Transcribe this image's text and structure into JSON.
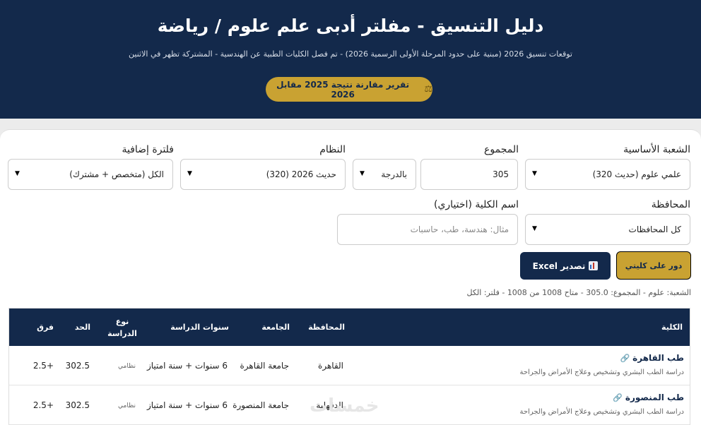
{
  "header": {
    "title": "دليل التنسيق - مفلتر أدبى علم علوم / رياضة",
    "subtitle": "توقعات تنسيق 2026 (مبنية على حدود المرحلة الأولى الرسمية 2026) - تم فصل الكليات الطبية عن الهندسية - المشتركة تظهر في الاثنين",
    "compare_button": "تقرير مقارنة نتيجة 2025 مقابل 2026",
    "compare_icon": "scale-icon"
  },
  "filters": {
    "branch_label": "الشعبة الأساسية",
    "branch_value": "علمي علوم (حديث 320)",
    "total_label": "المجموع",
    "total_value": "305",
    "total_unit": "بالدرجة",
    "system_label": "النظام",
    "system_value": "حديث 2026 (320)",
    "extra_label": "فلترة إضافية",
    "extra_value": "الكل (متخصص + مشترك)",
    "governorate_label": "المحافظة",
    "governorate_value": "كل المحافظات",
    "college_label": "اسم الكلية (اختياري)",
    "college_placeholder": "مثال: هندسة، طب، حاسبات"
  },
  "actions": {
    "find_label": "دور على كليتي",
    "export_label": "تصدير Excel",
    "export_icon": "chart-icon"
  },
  "summary": "الشعبة: علوم - المجموع: 305.0 - متاح 1008 من 1008 - فلتر: الكل",
  "table": {
    "headers": {
      "college": "الكلية",
      "governorate": "المحافظة",
      "university": "الجامعة",
      "years": "سنوات الدراسة",
      "study_type": "نوع الدراسة",
      "limit": "الحد",
      "diff": "فرق"
    },
    "rows": [
      {
        "name": "طب القاهرة",
        "desc": "دراسة الطب البشري وتشخيص وعلاج الأمراض والجراحة",
        "governorate": "القاهرة",
        "university": "جامعة القاهرة",
        "years": "6 سنوات + سنة امتياز",
        "study_type": "نظامي",
        "limit": "302.5",
        "diff": "+2.5"
      },
      {
        "name": "طب المنصورة",
        "desc": "دراسة الطب البشري وتشخيص وعلاج الأمراض والجراحة",
        "governorate": "الدقهلية",
        "university": "جامعة المنصورة",
        "years": "6 سنوات + سنة امتياز",
        "study_type": "نظامي",
        "limit": "302.5",
        "diff": "+2.5"
      }
    ]
  },
  "watermark": "خمسات",
  "colors": {
    "navy": "#13294b",
    "gold": "#c9a232"
  }
}
